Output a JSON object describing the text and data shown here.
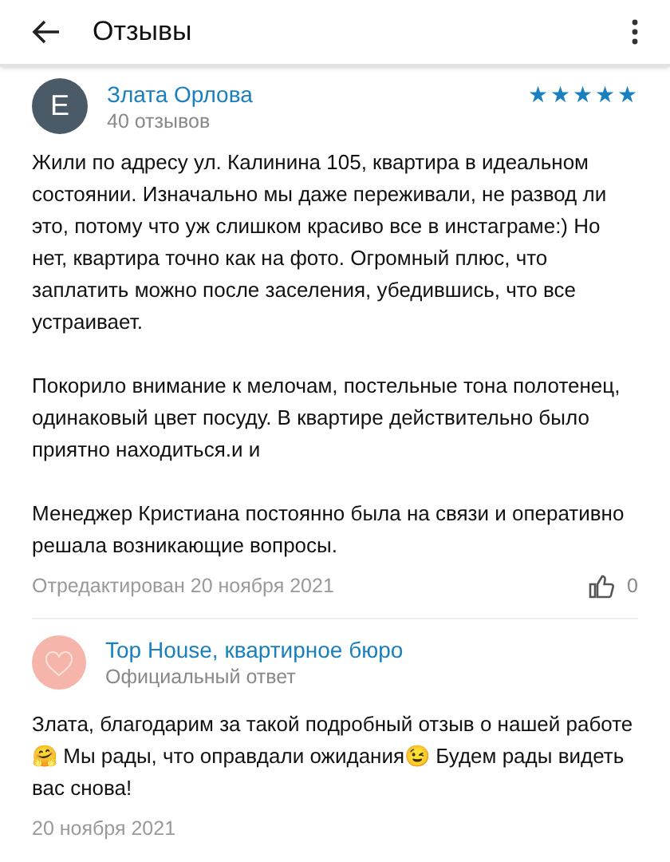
{
  "header": {
    "title": "Отзывы"
  },
  "review": {
    "avatar_letter": "E",
    "author": "Злата Орлова",
    "review_count": "40 отзывов",
    "stars": 5,
    "paragraphs": [
      "Жили по адресу ул. Калинина 105, квартира в идеальном состоянии. Изначально мы даже переживали, не развод ли это, потому что уж слишком красиво все в инстаграме:) Но нет, квартира точно как на фото. Огромный плюс, что заплатить можно после заселения, убедившись, что все устраивает.",
      "Покорило внимание к мелочам, постельные тона полотенец, одинаковый цвет посуду. В квартире действительно было приятно находиться.и и",
      "Менеджер Кристиана постоянно была на связи и оперативно решала возникающие вопросы."
    ],
    "edited": "Отредактирован 20 ноября 2021",
    "likes": "0"
  },
  "reply": {
    "author": "Top House, квартирное бюро",
    "subtitle": "Официальный ответ",
    "text": "Злата, благодарим за такой подробный отзыв о нашей работе 🤗 Мы рады, что оправдали ожидания😉 Будем рады видеть вас снова!",
    "date": "20 ноября 2021"
  }
}
